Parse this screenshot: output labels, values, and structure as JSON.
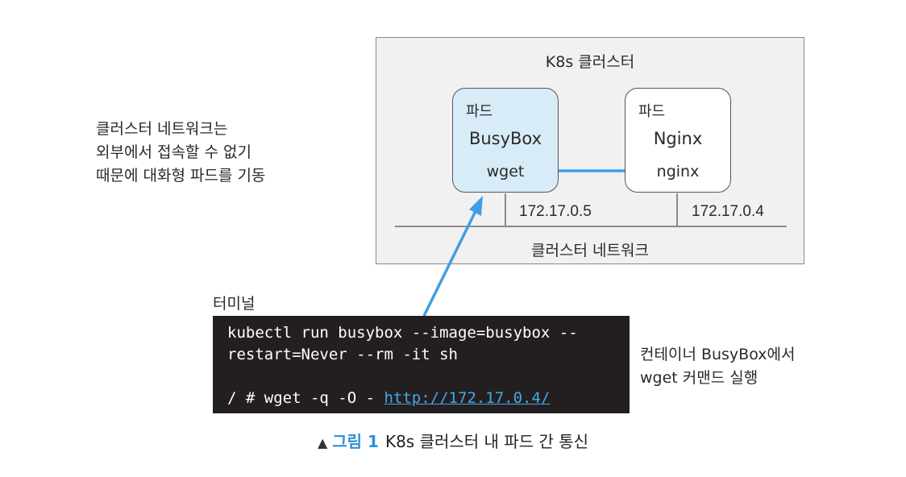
{
  "cluster": {
    "title": "K8s 클러스터",
    "network_label": "클러스터 네트워크",
    "pods": [
      {
        "label": "파드",
        "name": "BusyBox",
        "command": "wget",
        "ip": "172.17.0.5"
      },
      {
        "label": "파드",
        "name": "Nginx",
        "command": "nginx",
        "ip": "172.17.0.4"
      }
    ]
  },
  "side_note": [
    "클러스터 네트워크는",
    "외부에서 접속할 수 없기",
    "때문에 대화형 파드를 기동"
  ],
  "terminal": {
    "title": "터미널",
    "lines": [
      "kubectl run busybox --image=busybox --",
      "restart=Never --rm -it sh",
      "",
      "/ # wget -q -O - "
    ],
    "url": "http://172.17.0.4/"
  },
  "right_note": [
    "컨테이너 BusyBox에서",
    "wget 커맨드 실행"
  ],
  "caption": {
    "marker": "▲",
    "figure": "그림 1",
    "title": "K8s 클러스터 내 파드 간 통신"
  },
  "colors": {
    "arrow": "#3f9fe3",
    "busybox_fill": "#d7ecf7",
    "cluster_fill": "#f1f1f1",
    "terminal_bg": "#231f20",
    "link": "#47a7e6"
  }
}
